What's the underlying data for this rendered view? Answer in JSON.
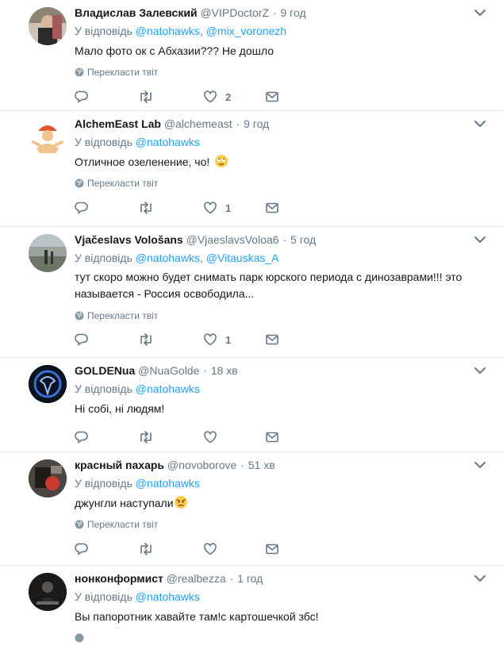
{
  "ui": {
    "reply_prefix": "У відповідь",
    "translate_label": "Перекласти твіт",
    "separator": "·",
    "comma": ","
  },
  "colors": {
    "link": "#1da1f2",
    "secondary": "#657786",
    "divider": "#e6ecf0"
  },
  "tweets": [
    {
      "name": "Владислав Залевский",
      "handle": "@VIPDoctorZ",
      "time": "9 год",
      "mentions": [
        "@natohawks",
        "@mix_voronezh"
      ],
      "text": "Мало фото ок с Абхазии??? Не дошло",
      "likes": "2",
      "emoji": ""
    },
    {
      "name": "AlchemEast Lab",
      "handle": "@alchemeast",
      "time": "9 год",
      "mentions": [
        "@natohawks"
      ],
      "text": "Отличное озеленение, чо!",
      "likes": "1",
      "emoji": "rolling-eyes-emoji"
    },
    {
      "name": "Vjačeslavs Vološans",
      "handle": "@VjaeslavsVoloa6",
      "time": "5 год",
      "mentions": [
        "@natohawks",
        "@Vitauskas_A"
      ],
      "text": "тут скоро можно будет снимать парк юрского периода с динозаврами!!! это называется - Россия освободила...",
      "likes": "1",
      "emoji": ""
    },
    {
      "name": "GOLDENua",
      "handle": "@NuaGolde",
      "time": "18 хв",
      "mentions": [
        "@natohawks"
      ],
      "text": "Ні собі, ні людям!",
      "likes": "",
      "emoji": ""
    },
    {
      "name": "красный пахарь",
      "handle": "@novoborove",
      "time": "51 хв",
      "mentions": [
        "@natohawks"
      ],
      "text": "джунгли наступали",
      "likes": "",
      "emoji": "angry-face-emoji"
    },
    {
      "name": "нонконформист",
      "handle": "@realbezza",
      "time": "1 год",
      "mentions": [
        "@natohawks"
      ],
      "text": "Вы папоротник хавайте там!с картошечкой збс!",
      "likes": "",
      "emoji": ""
    }
  ]
}
